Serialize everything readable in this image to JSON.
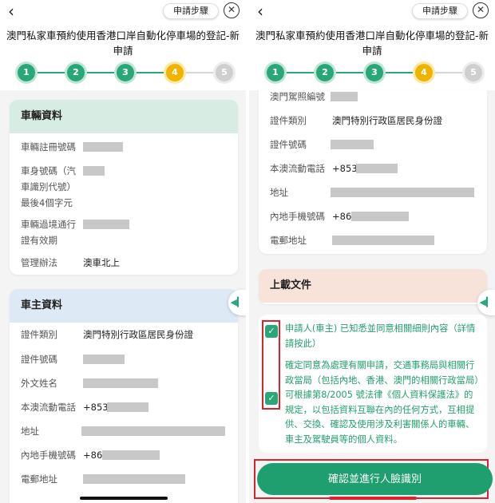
{
  "common": {
    "back_icon": "chevron-left-icon",
    "steps_button": "申請步驟",
    "close_icon": "close-icon",
    "title": "澳門私家車預約使用香港口岸自動化停車場的登記-新申請",
    "steps": [
      "1",
      "2",
      "3",
      "4",
      "5"
    ],
    "current_step": 4,
    "colors": {
      "accent": "#2aa779",
      "active": "#f0b400",
      "error": "#d9232d"
    }
  },
  "left": {
    "vehicle_card": {
      "title": "車輛資料",
      "reg_no_label": "車輛註冊號碼",
      "body_no_label_1": "車身號碼（汽",
      "body_no_label_2": "車識別代號）",
      "body_no_label_3": "最後4個字元",
      "permit_label_1": "車輛過境通行",
      "permit_label_2": "證有效期",
      "scheme_label": "管理辦法",
      "scheme_value": "澳車北上"
    },
    "owner_card": {
      "title": "車主資料",
      "id_type_label": "證件類別",
      "id_type_value": "澳門特別行政區居民身份證",
      "id_no_label": "證件號碼",
      "foreign_name_label": "外文姓名",
      "phone_label": "本澳流動電話",
      "phone_prefix": "+853",
      "address_label": "地址",
      "mainland_phone_label": "內地手機號碼",
      "mainland_prefix": "+86",
      "email_label": "電郵地址"
    }
  },
  "right": {
    "license_label": "澳門駕照編號",
    "id_type_label": "證件類別",
    "id_type_value": "澳門特別行政區居民身份證",
    "id_no_label": "證件號碼",
    "phone_label": "本澳流動電話",
    "phone_prefix": "+853",
    "address_label": "地址",
    "mainland_phone_label": "內地手機號碼",
    "mainland_prefix": "+86",
    "email_label": "電郵地址",
    "upload_title": "上載文件",
    "agree_1": "申請人(車主) 已知悉並同意相關細則內容（詳情請按此）",
    "agree_2": "確定同意為處理有關申請，交通事務局與相關行政當局（包括內地、香港、澳門的相關行政當局）可根據第8/2005 號法律《個人資料保護法》的規定，以包括資料互聯在內的任何方式，互相提供、交換、確認及使用涉及利害關係人的車輛、車主及駕駛員等的個人資料。",
    "confirm_button": "確認並進行人臉識別"
  }
}
